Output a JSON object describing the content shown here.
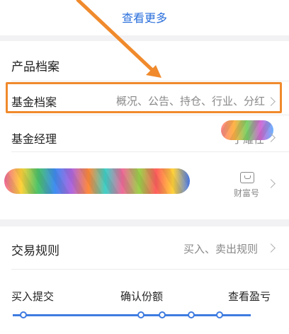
{
  "top": {
    "view_more": "查看更多"
  },
  "profile": {
    "title": "产品档案",
    "rows": [
      {
        "label": "基金档案",
        "value": "概况、公告、持仓、行业、分红"
      },
      {
        "label": "基金经理",
        "value": "于耀任"
      }
    ],
    "fortune_label": "财富号"
  },
  "trade": {
    "title": "交易规则",
    "value": "买入、卖出规则",
    "steps": [
      "买入提交",
      "确认份额",
      "查看盈亏"
    ]
  },
  "colors": {
    "accent": "#2a6fdc",
    "highlight": "#f08a2c",
    "track": "#3e7be0"
  },
  "icons": [
    "chevron-right-icon",
    "fortune-icon",
    "arrow-annotation-icon"
  ]
}
